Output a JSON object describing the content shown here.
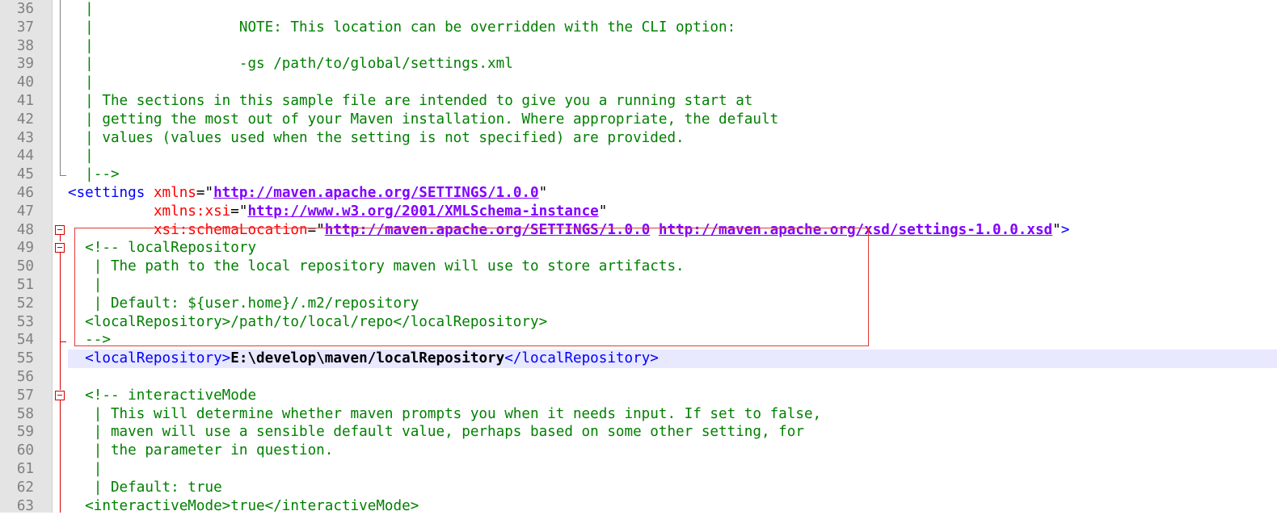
{
  "editor": {
    "current_line": 55,
    "lines": [
      {
        "num": "36",
        "parts": [
          {
            "t": "comment",
            "v": "  |"
          }
        ]
      },
      {
        "num": "37",
        "parts": [
          {
            "t": "comment",
            "v": "  |                 NOTE: This location can be overridden with the CLI option:"
          }
        ]
      },
      {
        "num": "38",
        "parts": [
          {
            "t": "comment",
            "v": "  |"
          }
        ]
      },
      {
        "num": "39",
        "parts": [
          {
            "t": "comment",
            "v": "  |                 -gs /path/to/global/settings.xml"
          }
        ]
      },
      {
        "num": "40",
        "parts": [
          {
            "t": "comment",
            "v": "  |"
          }
        ]
      },
      {
        "num": "41",
        "parts": [
          {
            "t": "comment",
            "v": "  | The sections in this sample file are intended to give you a running start at"
          }
        ]
      },
      {
        "num": "42",
        "parts": [
          {
            "t": "comment",
            "v": "  | getting the most out of your Maven installation. Where appropriate, the default"
          }
        ]
      },
      {
        "num": "43",
        "parts": [
          {
            "t": "comment",
            "v": "  | values (values used when the setting is not specified) are provided."
          }
        ]
      },
      {
        "num": "44",
        "parts": [
          {
            "t": "comment",
            "v": "  |"
          }
        ]
      },
      {
        "num": "45",
        "parts": [
          {
            "t": "comment",
            "v": "  |-->"
          }
        ]
      },
      {
        "num": "46",
        "parts": [
          {
            "t": "tag",
            "v": "<settings "
          },
          {
            "t": "attr",
            "v": "xmlns"
          },
          {
            "t": "punct",
            "v": "=\""
          },
          {
            "t": "str",
            "v": "http://maven.apache.org/SETTINGS/1.0.0"
          },
          {
            "t": "punct",
            "v": "\""
          }
        ]
      },
      {
        "num": "47",
        "parts": [
          {
            "t": "punct",
            "v": "          "
          },
          {
            "t": "attr",
            "v": "xmlns:xsi"
          },
          {
            "t": "punct",
            "v": "=\""
          },
          {
            "t": "str",
            "v": "http://www.w3.org/2001/XMLSchema-instance"
          },
          {
            "t": "punct",
            "v": "\""
          }
        ]
      },
      {
        "num": "48",
        "parts": [
          {
            "t": "punct",
            "v": "          "
          },
          {
            "t": "attr",
            "v": "xsi:schemaLocation"
          },
          {
            "t": "punct",
            "v": "=\""
          },
          {
            "t": "str",
            "v": "http://maven.apache.org/SETTINGS/1.0.0"
          },
          {
            "t": "punct",
            "v": " "
          },
          {
            "t": "str",
            "v": "http://maven.apache.org/xsd/settings-1.0.0.xsd"
          },
          {
            "t": "punct",
            "v": "\""
          },
          {
            "t": "tag",
            "v": ">"
          }
        ]
      },
      {
        "num": "49",
        "parts": [
          {
            "t": "comment",
            "v": "  <!-- localRepository"
          }
        ]
      },
      {
        "num": "50",
        "parts": [
          {
            "t": "comment",
            "v": "   | The path to the local repository maven will use to store artifacts."
          }
        ]
      },
      {
        "num": "51",
        "parts": [
          {
            "t": "comment",
            "v": "   |"
          }
        ]
      },
      {
        "num": "52",
        "parts": [
          {
            "t": "comment",
            "v": "   | Default: ${user.home}/.m2/repository"
          }
        ]
      },
      {
        "num": "53",
        "parts": [
          {
            "t": "comment",
            "v": "  <localRepository>/path/to/local/repo</localRepository>"
          }
        ]
      },
      {
        "num": "54",
        "parts": [
          {
            "t": "comment",
            "v": "  -->"
          }
        ]
      },
      {
        "num": "55",
        "parts": [
          {
            "t": "tag",
            "v": "  <localRepository>"
          },
          {
            "t": "bold",
            "v": "E:\\develop\\maven/localRepository"
          },
          {
            "t": "tag",
            "v": "</localRepository>"
          }
        ]
      },
      {
        "num": "56",
        "parts": [
          {
            "t": "punct",
            "v": ""
          }
        ]
      },
      {
        "num": "57",
        "parts": [
          {
            "t": "comment",
            "v": "  <!-- interactiveMode"
          }
        ]
      },
      {
        "num": "58",
        "parts": [
          {
            "t": "comment",
            "v": "   | This will determine whether maven prompts you when it needs input. If set to false,"
          }
        ]
      },
      {
        "num": "59",
        "parts": [
          {
            "t": "comment",
            "v": "   | maven will use a sensible default value, perhaps based on some other setting, for"
          }
        ]
      },
      {
        "num": "60",
        "parts": [
          {
            "t": "comment",
            "v": "   | the parameter in question."
          }
        ]
      },
      {
        "num": "61",
        "parts": [
          {
            "t": "comment",
            "v": "   |"
          }
        ]
      },
      {
        "num": "62",
        "parts": [
          {
            "t": "comment",
            "v": "   | Default: true"
          }
        ]
      },
      {
        "num": "63",
        "parts": [
          {
            "t": "comment",
            "v": "  <interactiveMode>true</interactiveMode>"
          }
        ]
      }
    ]
  },
  "colors": {
    "comment": "#008000",
    "tag": "#0000ff",
    "attr": "#ff0000",
    "string": "#8000ff",
    "current_line_bg": "#e8e8ff",
    "highlight_box": "#e53935",
    "gutter_bg": "#e4e4e4"
  },
  "icons": [
    "fold-collapse-icon"
  ]
}
